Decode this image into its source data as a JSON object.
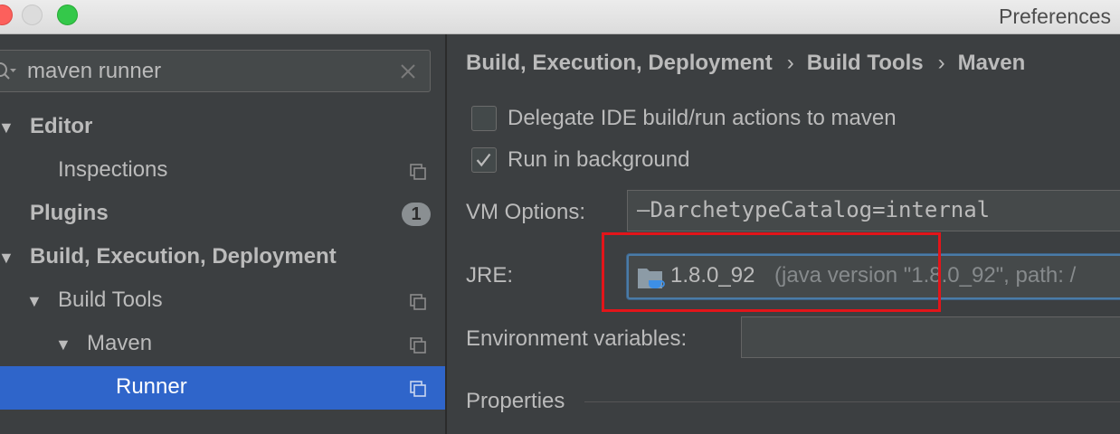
{
  "window": {
    "title": "Preferences"
  },
  "search": {
    "value": "maven runner"
  },
  "sidebar": {
    "items": [
      {
        "label": "Editor",
        "expanded": true
      },
      {
        "label": "Inspections"
      },
      {
        "label": "Plugins",
        "badge": "1"
      },
      {
        "label": "Build, Execution, Deployment",
        "expanded": true
      },
      {
        "label": "Build Tools",
        "expanded": true
      },
      {
        "label": "Maven",
        "expanded": true
      },
      {
        "label": "Runner",
        "selected": true
      }
    ]
  },
  "breadcrumb": [
    "Build, Execution, Deployment",
    "Build Tools",
    "Maven"
  ],
  "options": {
    "delegate": {
      "label": "Delegate IDE build/run actions to maven",
      "checked": false
    },
    "background": {
      "label": "Run in background",
      "checked": true
    }
  },
  "vm_options": {
    "label": "VM Options:",
    "value": "–DarchetypeCatalog=internal"
  },
  "jre": {
    "label": "JRE:",
    "value": "1.8.0_92",
    "detail": "(java version \"1.8.0_92\", path: /"
  },
  "env": {
    "label": "Environment variables:",
    "value": ""
  },
  "properties": {
    "title": "Properties"
  },
  "colors": {
    "selection": "#2f65ca",
    "highlight": "#e3151a",
    "background": "#3c3f41"
  }
}
